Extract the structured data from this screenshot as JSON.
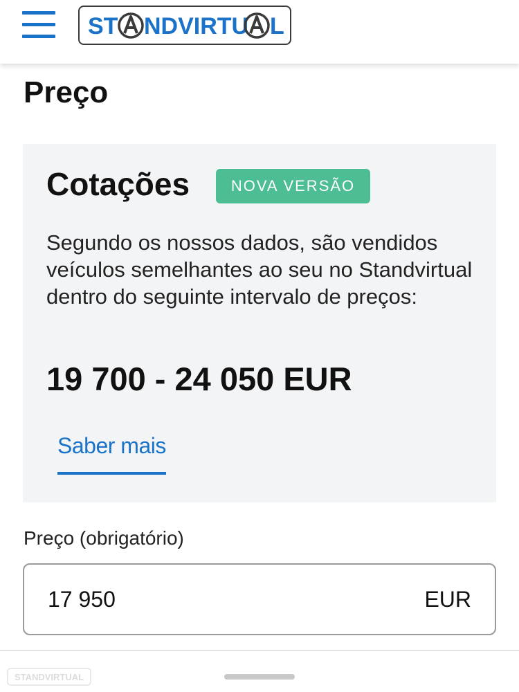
{
  "header": {
    "menu_icon": "hamburger-menu-icon",
    "logo_text": "STANDVIRTUAL",
    "brand_color": "#1a73c8"
  },
  "page": {
    "title": "Preço"
  },
  "quote_card": {
    "title": "Cotações",
    "badge": "NOVA VERSÃO",
    "badge_color": "#4dbe94",
    "description": "Segundo os nossos dados, são vendidos veículos semelhantes ao seu no Standvirtual dentro do seguinte intervalo de preços:",
    "price_range": "19 700 - 24 050 EUR",
    "learn_more": "Saber mais"
  },
  "price_field": {
    "label": "Preço (obrigatório)",
    "value": "17 950",
    "currency": "EUR"
  },
  "watermark_text": "STANDVIRTUAL"
}
